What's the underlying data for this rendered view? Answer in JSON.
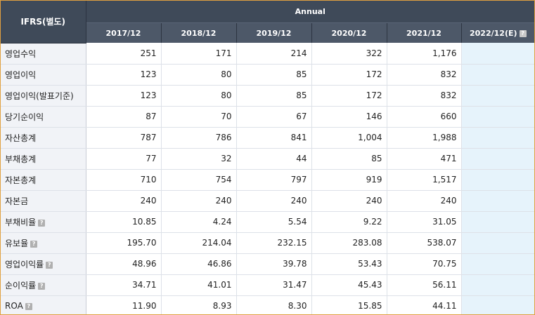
{
  "table": {
    "corner_label": "IFRS(별도)",
    "group_label": "Annual",
    "years": [
      "2017/12",
      "2018/12",
      "2019/12",
      "2020/12",
      "2021/12",
      "2022/12(E)"
    ],
    "help_glyph": "?",
    "rows": [
      {
        "label": "영업수익",
        "help": false,
        "values": [
          "251",
          "171",
          "214",
          "322",
          "1,176",
          ""
        ]
      },
      {
        "label": "영업이익",
        "help": false,
        "values": [
          "123",
          "80",
          "85",
          "172",
          "832",
          ""
        ]
      },
      {
        "label": "영업이익(발표기준)",
        "help": false,
        "values": [
          "123",
          "80",
          "85",
          "172",
          "832",
          ""
        ]
      },
      {
        "label": "당기순이익",
        "help": false,
        "values": [
          "87",
          "70",
          "67",
          "146",
          "660",
          ""
        ]
      },
      {
        "label": "자산총계",
        "help": false,
        "values": [
          "787",
          "786",
          "841",
          "1,004",
          "1,988",
          ""
        ]
      },
      {
        "label": "부채총계",
        "help": false,
        "values": [
          "77",
          "32",
          "44",
          "85",
          "471",
          ""
        ]
      },
      {
        "label": "자본총계",
        "help": false,
        "values": [
          "710",
          "754",
          "797",
          "919",
          "1,517",
          ""
        ]
      },
      {
        "label": "자본금",
        "help": false,
        "values": [
          "240",
          "240",
          "240",
          "240",
          "240",
          ""
        ]
      },
      {
        "label": "부채비율",
        "help": true,
        "values": [
          "10.85",
          "4.24",
          "5.54",
          "9.22",
          "31.05",
          ""
        ]
      },
      {
        "label": "유보율",
        "help": true,
        "values": [
          "195.70",
          "214.04",
          "232.15",
          "283.08",
          "538.07",
          ""
        ]
      },
      {
        "label": "영업이익률",
        "help": true,
        "values": [
          "48.96",
          "46.86",
          "39.78",
          "53.43",
          "70.75",
          ""
        ]
      },
      {
        "label": "순이익률",
        "help": true,
        "values": [
          "34.71",
          "41.01",
          "31.47",
          "45.43",
          "56.11",
          ""
        ]
      },
      {
        "label": "ROA",
        "help": true,
        "values": [
          "11.90",
          "8.93",
          "8.30",
          "15.85",
          "44.11",
          ""
        ]
      }
    ]
  }
}
